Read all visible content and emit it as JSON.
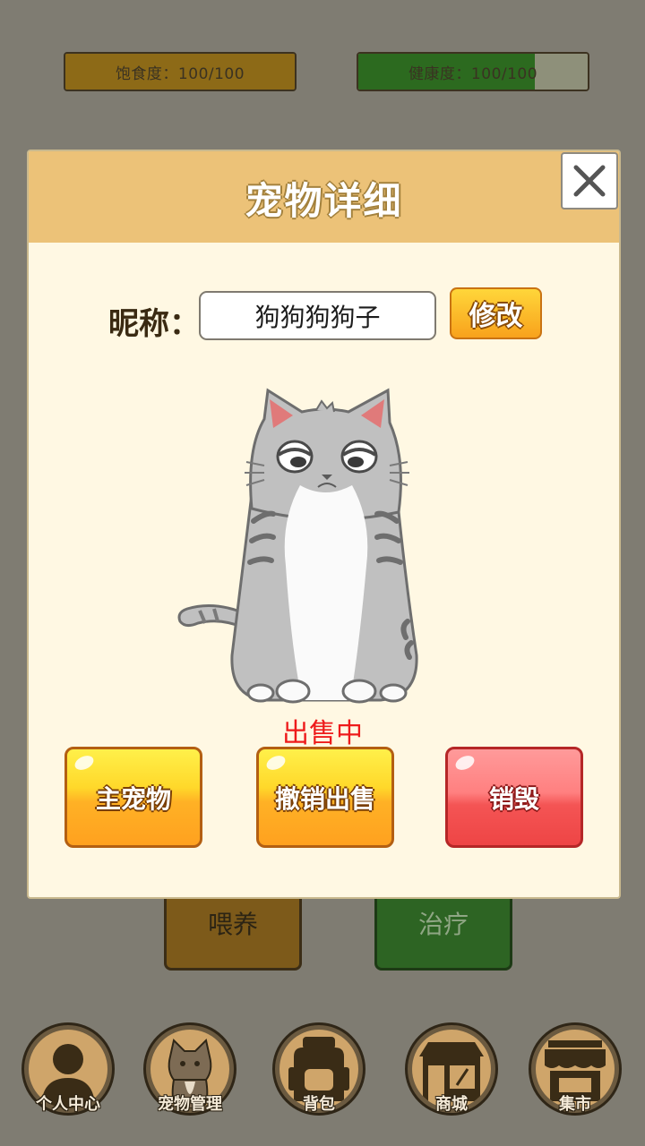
{
  "stats": {
    "satiety_label": "饱食度：100/100",
    "satiety_level": 1.0,
    "health_label": "健康度：100/100",
    "health_level": 0.77
  },
  "background_actions": {
    "feed_label": "喂养",
    "heal_label": "治疗"
  },
  "nav": {
    "items": [
      {
        "label": "个人中心",
        "icon": "person-icon"
      },
      {
        "label": "宠物管理",
        "icon": "cat-icon"
      },
      {
        "label": "背包",
        "icon": "backpack-icon"
      },
      {
        "label": "商城",
        "icon": "shop-icon"
      },
      {
        "label": "集市",
        "icon": "market-icon"
      }
    ]
  },
  "modal": {
    "title": "宠物详细",
    "close_icon": "close-icon",
    "nickname_label": "昵称：",
    "nickname_value": "狗狗狗狗子",
    "edit_label": "修改",
    "status_text": "出售中",
    "actions": {
      "set_main_label": "主宠物",
      "cancel_sale_label": "撤销出售",
      "destroy_label": "销毁"
    }
  },
  "colors": {
    "status_red": "#ee1b1b",
    "header_gold": "#ecc278",
    "panel_cream": "#fff8e3",
    "button_yellow": "#ffb125",
    "button_red": "#ee4545"
  }
}
